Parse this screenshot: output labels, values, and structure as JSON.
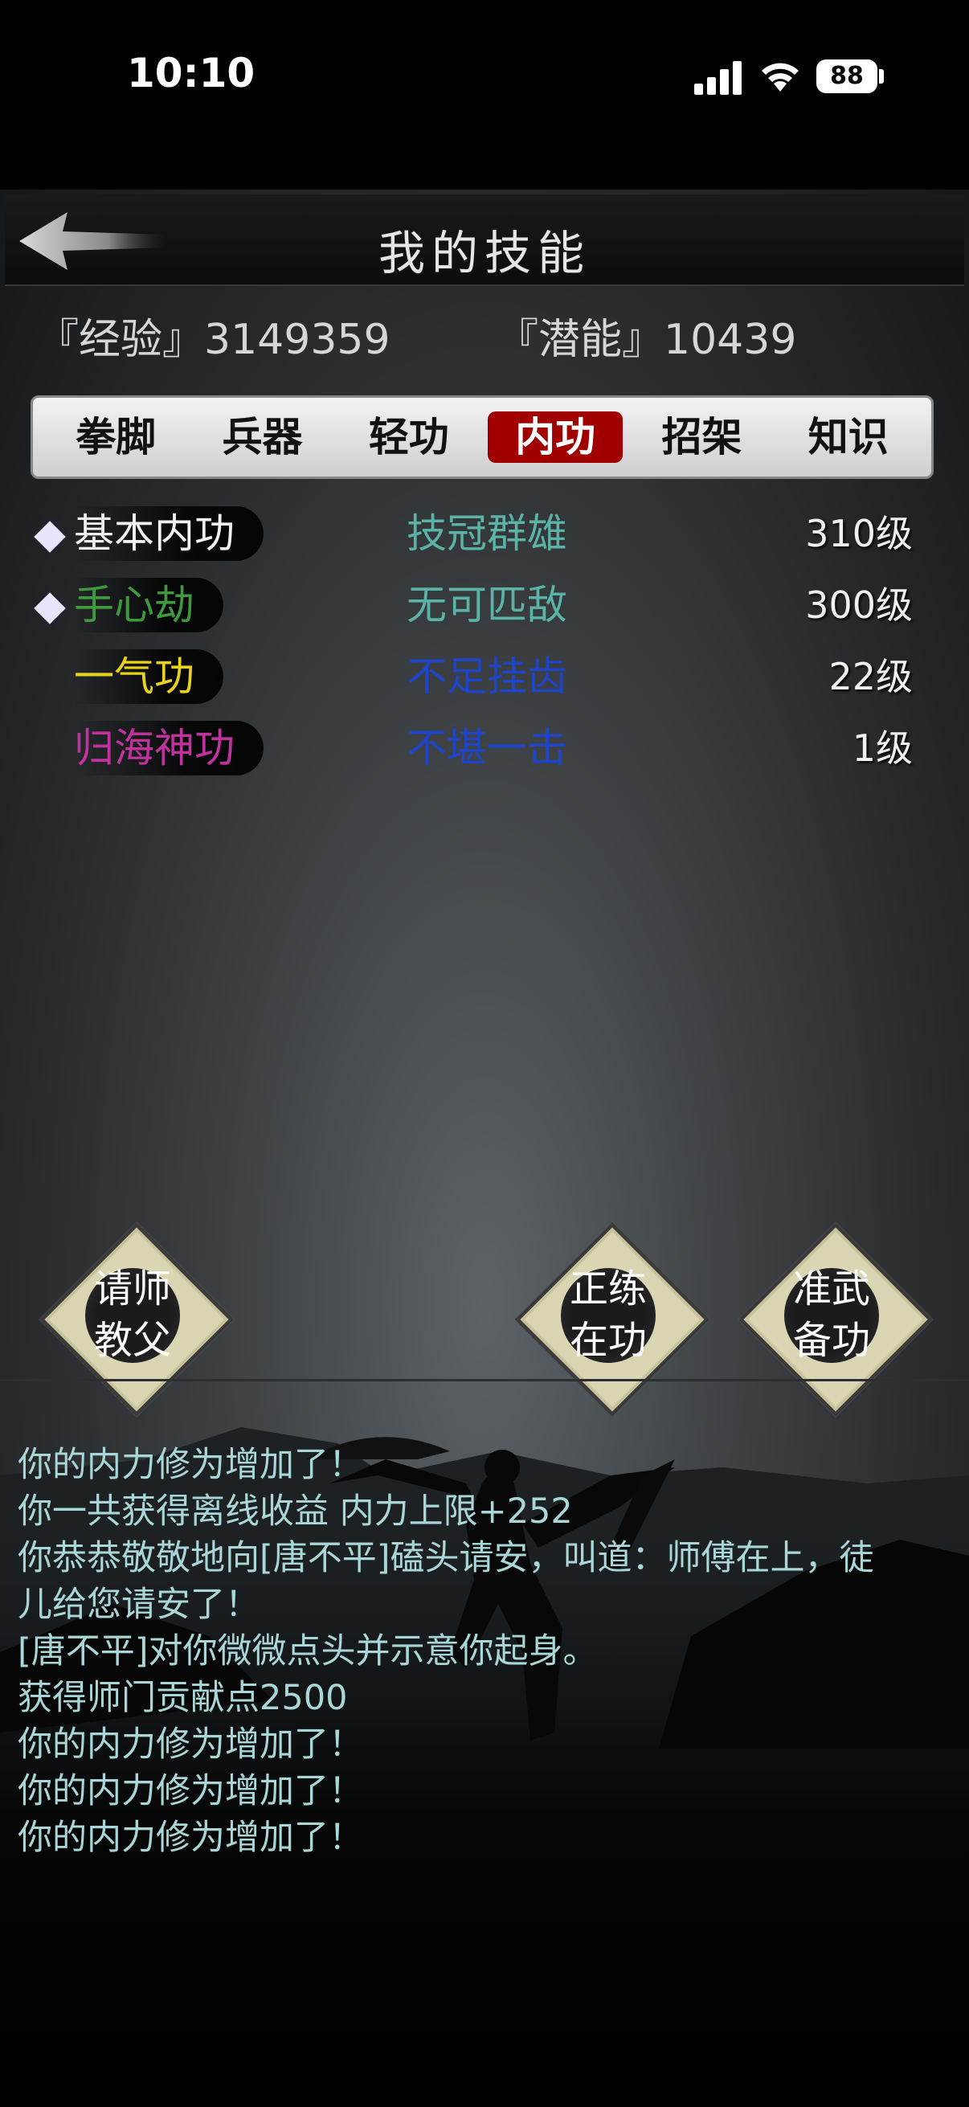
{
  "status_bar": {
    "time": "10:10",
    "battery": "88"
  },
  "header": {
    "title": "我的技能"
  },
  "stats": {
    "experience": "『经验』3149359",
    "potential": "『潜能』10439"
  },
  "tabs": [
    "拳脚",
    "兵器",
    "轻功",
    "内功",
    "招架",
    "知识"
  ],
  "active_tab": "内功",
  "skills": [
    {
      "name": "基本内功",
      "rank": "技冠群雄",
      "level": "310级",
      "name_color": "#f2f2f2",
      "rank_color": "#5bb3a6",
      "marked": true
    },
    {
      "name": "手心劫",
      "rank": "无可匹敌",
      "level": "300级",
      "name_color": "#3e9a3e",
      "rank_color": "#5bb3a6",
      "marked": true
    },
    {
      "name": "一气功",
      "rank": "不足挂齿",
      "level": "22级",
      "name_color": "#e8d21c",
      "rank_color": "#1e44c8",
      "marked": false
    },
    {
      "name": "归海神功",
      "rank": "不堪一击",
      "level": "1级",
      "name_color": "#c0329e",
      "rank_color": "#1e44c8",
      "marked": false
    }
  ],
  "actions": {
    "master": [
      "请师",
      "教父"
    ],
    "practice": [
      "正练",
      "在功"
    ],
    "prepare": [
      "准武",
      "备功"
    ]
  },
  "log": [
    "你的内力修为增加了！",
    "你一共获得离线收益 内力上限+252",
    "你恭恭敬敬地向[唐不平]磕头请安，叫道：师傅在上，徒",
    "儿给您请安了！",
    "[唐不平]对你微微点头并示意你起身。",
    "获得师门贡献点2500",
    "你的内力修为增加了！",
    "你的内力修为增加了！",
    "你的内力修为增加了！"
  ]
}
